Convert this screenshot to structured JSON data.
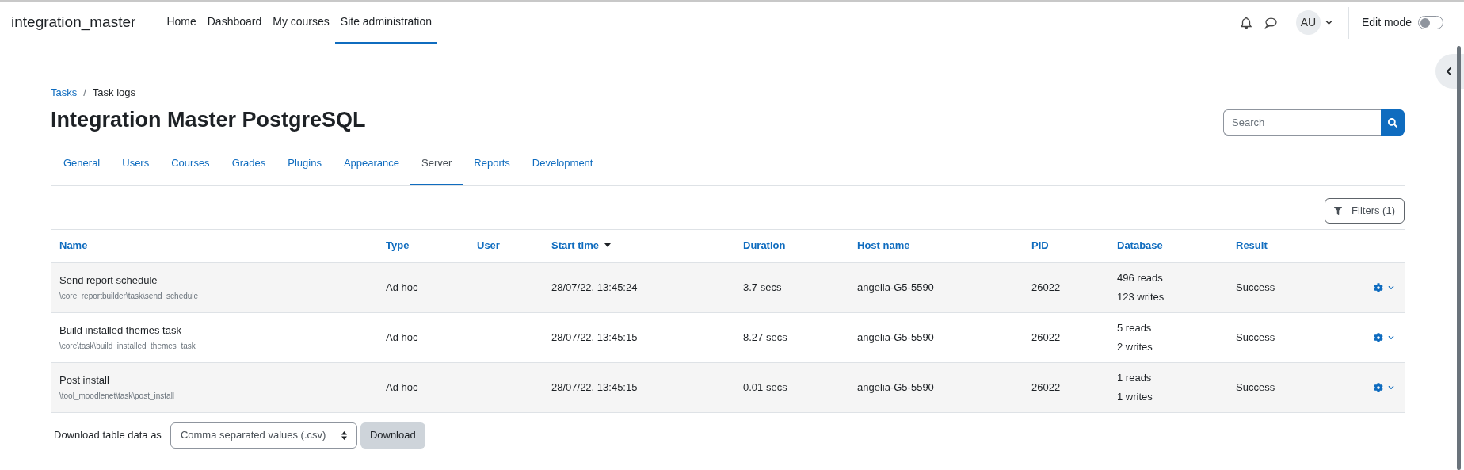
{
  "navbar": {
    "site_name": "integration_master",
    "links": [
      {
        "label": "Home",
        "selected": false
      },
      {
        "label": "Dashboard",
        "selected": false
      },
      {
        "label": "My courses",
        "selected": false
      },
      {
        "label": "Site administration",
        "selected": true
      }
    ],
    "user_initials": "AU",
    "edit_mode": {
      "label": "Edit mode",
      "on": false
    }
  },
  "breadcrumb_separator": "/",
  "breadcrumbs": [
    {
      "label": "Tasks",
      "kind": "link"
    },
    {
      "label": "Task logs",
      "kind": "current"
    }
  ],
  "page_title": "Integration Master PostgreSQL",
  "search": {
    "placeholder": "Search"
  },
  "tabs": [
    {
      "label": "General",
      "selected": false
    },
    {
      "label": "Users",
      "selected": false
    },
    {
      "label": "Courses",
      "selected": false
    },
    {
      "label": "Grades",
      "selected": false
    },
    {
      "label": "Plugins",
      "selected": false
    },
    {
      "label": "Appearance",
      "selected": false
    },
    {
      "label": "Server",
      "selected": true
    },
    {
      "label": "Reports",
      "selected": false
    },
    {
      "label": "Development",
      "selected": false
    }
  ],
  "filters_button": "Filters (1)",
  "table": {
    "columns": [
      {
        "label": "Name",
        "sorted": false
      },
      {
        "label": "Type",
        "sorted": false
      },
      {
        "label": "User",
        "sorted": false
      },
      {
        "label": "Start time",
        "sorted": true
      },
      {
        "label": "Duration",
        "sorted": false
      },
      {
        "label": "Host name",
        "sorted": false
      },
      {
        "label": "PID",
        "sorted": false
      },
      {
        "label": "Database",
        "sorted": false
      },
      {
        "label": "Result",
        "sorted": false
      }
    ],
    "rows": [
      {
        "name": "Send report schedule",
        "classname": "\\core_reportbuilder\\task\\send_schedule",
        "type": "Ad hoc",
        "start_time": "28/07/22, 13:45:24",
        "duration": "3.7 secs",
        "host_name": "angelia-G5-5590",
        "pid": "26022",
        "reads": "496 reads",
        "writes": "123 writes",
        "result": "Success"
      },
      {
        "name": "Build installed themes task",
        "classname": "\\core\\task\\build_installed_themes_task",
        "type": "Ad hoc",
        "start_time": "28/07/22, 13:45:15",
        "duration": "8.27 secs",
        "host_name": "angelia-G5-5590",
        "pid": "26022",
        "reads": "5 reads",
        "writes": "2 writes",
        "result": "Success"
      },
      {
        "name": "Post install",
        "classname": "\\tool_moodlenet\\task\\post_install",
        "type": "Ad hoc",
        "start_time": "28/07/22, 13:45:15",
        "duration": "0.01 secs",
        "host_name": "angelia-G5-5590",
        "pid": "26022",
        "reads": "1 reads",
        "writes": "1 writes",
        "result": "Success"
      }
    ]
  },
  "download": {
    "label": "Download table data as",
    "format": "Comma separated values (.csv)",
    "button": "Download"
  }
}
